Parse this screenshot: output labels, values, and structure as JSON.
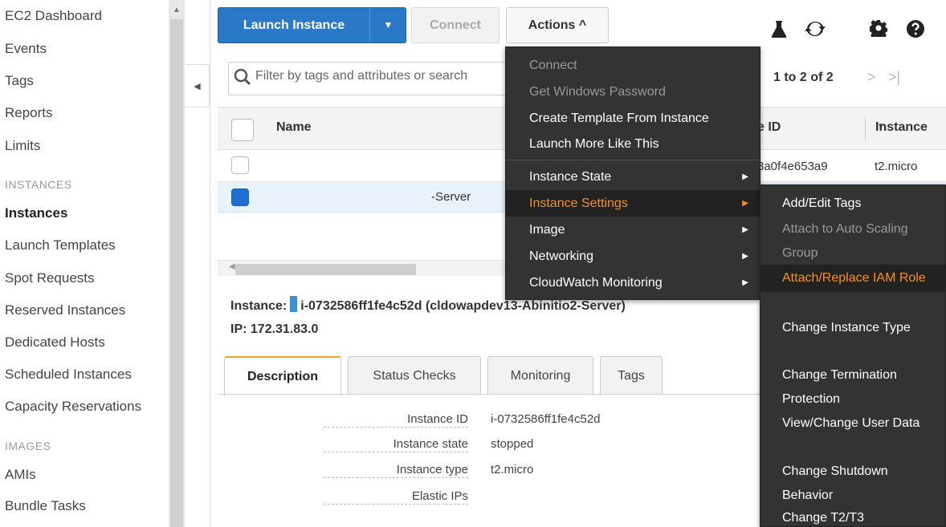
{
  "sidebar": {
    "items": [
      {
        "label": "EC2 Dashboard"
      },
      {
        "label": "Events"
      },
      {
        "label": "Tags"
      },
      {
        "label": "Reports"
      },
      {
        "label": "Limits"
      }
    ],
    "section_instances": "INSTANCES",
    "instances_items": [
      {
        "label": "Instances",
        "active": true
      },
      {
        "label": "Launch Templates"
      },
      {
        "label": "Spot Requests"
      },
      {
        "label": "Reserved Instances"
      },
      {
        "label": "Dedicated Hosts"
      },
      {
        "label": "Scheduled Instances"
      },
      {
        "label": "Capacity Reservations"
      }
    ],
    "section_images": "IMAGES",
    "images_items": [
      {
        "label": "AMIs"
      },
      {
        "label": "Bundle Tasks"
      }
    ]
  },
  "toolbar": {
    "launch_label": "Launch Instance",
    "connect_label": "Connect",
    "actions_label": "Actions ^",
    "icons": [
      "flask-icon",
      "refresh-icon",
      "gear-icon",
      "help-icon"
    ]
  },
  "filter": {
    "placeholder": "Filter by tags and attributes or search"
  },
  "pager": {
    "text": "1 to 2 of 2",
    "next": ">",
    "last": ">|"
  },
  "table": {
    "headers": {
      "name": "Name",
      "id": "e ID",
      "type": "Instance"
    },
    "rows": [
      {
        "name": "",
        "id": "3a0f4e653a9",
        "type": "t2.micro",
        "selected": false
      },
      {
        "name": "-Server",
        "id": "",
        "type": "",
        "selected": true
      }
    ]
  },
  "detail": {
    "title_prefix": "Instance:",
    "title_value": "i-0732586ff1fe4c52d (cldowapdev13-Abinitio2-Server)",
    "ip": "IP: 172.31.83.0",
    "tabs": [
      "Description",
      "Status Checks",
      "Monitoring",
      "Tags"
    ],
    "fields": [
      {
        "key": "Instance ID",
        "value": "i-0732586ff1fe4c52d"
      },
      {
        "key": "Instance state",
        "value": "stopped"
      },
      {
        "key": "Instance type",
        "value": "t2.micro"
      },
      {
        "key": "Elastic IPs",
        "value": ""
      }
    ]
  },
  "actions_menu": {
    "items": [
      {
        "label": "Connect",
        "disabled": true
      },
      {
        "label": "Get Windows Password",
        "disabled": true
      },
      {
        "label": "Create Template From Instance"
      },
      {
        "label": "Launch More Like This"
      },
      {
        "label": "Instance State",
        "submenu": true
      },
      {
        "label": "Instance Settings",
        "submenu": true,
        "highlighted": true
      },
      {
        "label": "Image",
        "submenu": true
      },
      {
        "label": "Networking",
        "submenu": true
      },
      {
        "label": "CloudWatch Monitoring",
        "submenu": true
      }
    ]
  },
  "settings_submenu": {
    "items": [
      {
        "label": "Add/Edit Tags"
      },
      {
        "label": "Attach to Auto Scaling Group",
        "disabled": true
      },
      {
        "label": "Attach/Replace IAM Role",
        "highlighted": true
      },
      {
        "label": "Change Instance Type"
      },
      {
        "label": "Change Termination Protection"
      },
      {
        "label": "View/Change User Data"
      },
      {
        "label": "Change Shutdown Behavior"
      },
      {
        "label": "Change T2/T3"
      }
    ]
  },
  "colors": {
    "primary": "#2a78c8",
    "menu_bg": "#333333",
    "menu_highlight": "#f7921e",
    "selected_row": "#e8f2fb",
    "tab_accent": "#f0a326"
  }
}
